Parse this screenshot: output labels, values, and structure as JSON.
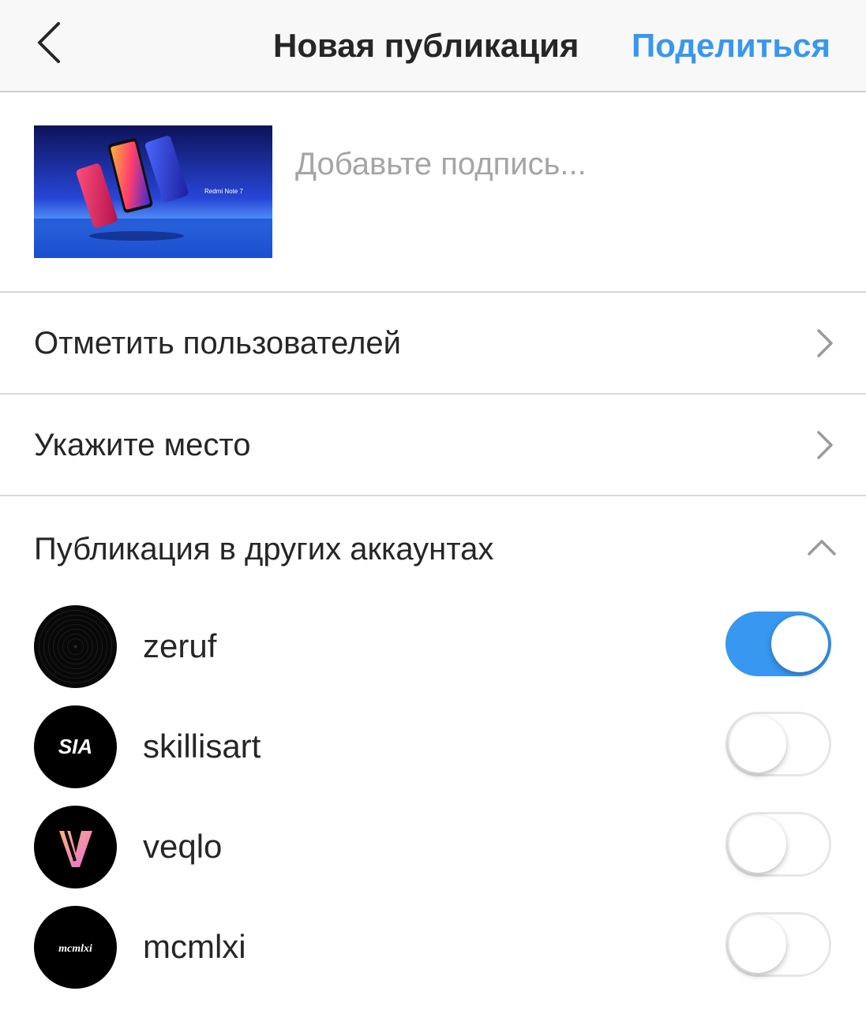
{
  "header": {
    "title": "Новая публикация",
    "share_label": "Поделиться",
    "back_icon": "chevron-left-icon"
  },
  "compose": {
    "caption_placeholder": "Добавьте подпись...",
    "thumbnail_text": "Redmi Note 7"
  },
  "options": {
    "tag_people": "Отметить пользователей",
    "add_location": "Укажите место"
  },
  "cross_post": {
    "label": "Публикация в других аккаунтах",
    "expanded": true,
    "accounts": [
      {
        "name": "zeruf",
        "enabled": true,
        "logo_text": ""
      },
      {
        "name": "skillisart",
        "enabled": false,
        "logo_text": "SIA"
      },
      {
        "name": "veqlo",
        "enabled": false,
        "logo_text": "V"
      },
      {
        "name": "mcmlxi",
        "enabled": false,
        "logo_text": "mcmlxi"
      }
    ]
  },
  "colors": {
    "accent": "#3897f0",
    "text": "#262626",
    "placeholder": "#a5a5a5"
  }
}
